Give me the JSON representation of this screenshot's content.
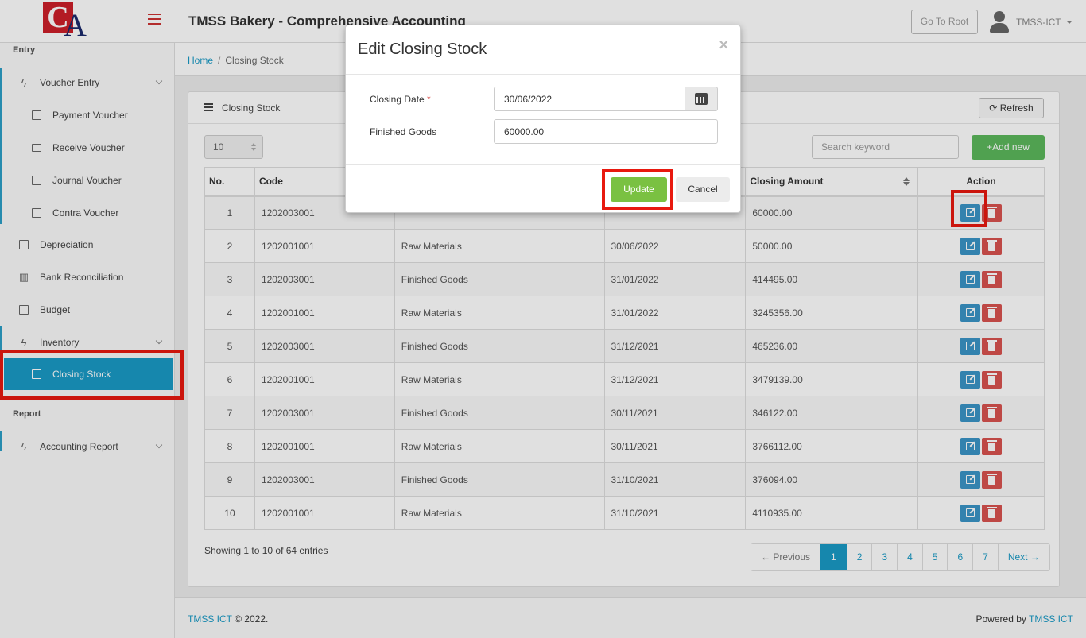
{
  "app": {
    "logo_letters": [
      "C",
      "A"
    ],
    "title": "TMSS Bakery - Comprehensive Accounting",
    "go_root": "Go To Root",
    "user": "TMSS-ICT"
  },
  "sidebar": {
    "sections": [
      {
        "label": "Entry"
      },
      {
        "label": "Report"
      }
    ],
    "items": [
      {
        "label": "Voucher Entry",
        "icon": "bolt-icon"
      },
      {
        "label": "Payment Voucher",
        "icon": "external-link-icon"
      },
      {
        "label": "Receive Voucher",
        "icon": "comment-icon"
      },
      {
        "label": "Journal Voucher",
        "icon": "edit-icon"
      },
      {
        "label": "Contra Voucher",
        "icon": "list-icon"
      },
      {
        "label": "Depreciation",
        "icon": "external-link-icon"
      },
      {
        "label": "Bank Reconciliation",
        "icon": "bar-chart-icon"
      },
      {
        "label": "Budget",
        "icon": "external-link-icon"
      },
      {
        "label": "Inventory",
        "icon": "bolt-icon"
      },
      {
        "label": "Closing Stock",
        "icon": "external-link-icon",
        "active": true
      },
      {
        "label": "Accounting Report",
        "icon": "bolt-icon"
      }
    ]
  },
  "breadcrumb": {
    "home": "Home",
    "current": "Closing Stock"
  },
  "card": {
    "title": "Closing Stock",
    "refresh": "Refresh",
    "page_size": "10",
    "search_placeholder": "Search keyword",
    "add_new": "Add new"
  },
  "table": {
    "headers": [
      "No.",
      "Code",
      "",
      "",
      "Closing Amount",
      "Action"
    ],
    "rows": [
      [
        "1",
        "1202003001",
        "",
        "",
        "60000.00"
      ],
      [
        "2",
        "1202001001",
        "Raw Materials",
        "30/06/2022",
        "50000.00"
      ],
      [
        "3",
        "1202003001",
        "Finished Goods",
        "31/01/2022",
        "414495.00"
      ],
      [
        "4",
        "1202001001",
        "Raw Materials",
        "31/01/2022",
        "3245356.00"
      ],
      [
        "5",
        "1202003001",
        "Finished Goods",
        "31/12/2021",
        "465236.00"
      ],
      [
        "6",
        "1202001001",
        "Raw Materials",
        "31/12/2021",
        "3479139.00"
      ],
      [
        "7",
        "1202003001",
        "Finished Goods",
        "30/11/2021",
        "346122.00"
      ],
      [
        "8",
        "1202001001",
        "Raw Materials",
        "30/11/2021",
        "3766112.00"
      ],
      [
        "9",
        "1202003001",
        "Finished Goods",
        "31/10/2021",
        "376094.00"
      ],
      [
        "10",
        "1202001001",
        "Raw Materials",
        "31/10/2021",
        "4110935.00"
      ]
    ]
  },
  "pagination": {
    "showing": "Showing 1 to 10 of 64 entries",
    "prev": "← Previous",
    "pages": [
      "1",
      "2",
      "3",
      "4",
      "5",
      "6",
      "7"
    ],
    "current": "1",
    "next": "Next →"
  },
  "footer": {
    "brand": "TMSS ICT",
    "copyright": "© 2022.",
    "powered_by": "Powered by",
    "powered_brand": "TMSS ICT"
  },
  "modal": {
    "title": "Edit Closing Stock",
    "close": "×",
    "closing_date_label": "Closing Date",
    "required_mark": "*",
    "closing_date_value": "30/06/2022",
    "finished_goods_label": "Finished Goods",
    "finished_goods_value": "60000.00",
    "update": "Update",
    "cancel": "Cancel"
  },
  "colors": {
    "accent": "#1a9ac5",
    "success": "#5cb85c",
    "update_green": "#7ac142",
    "danger": "#d9534f",
    "highlight_red": "#e8190f"
  }
}
